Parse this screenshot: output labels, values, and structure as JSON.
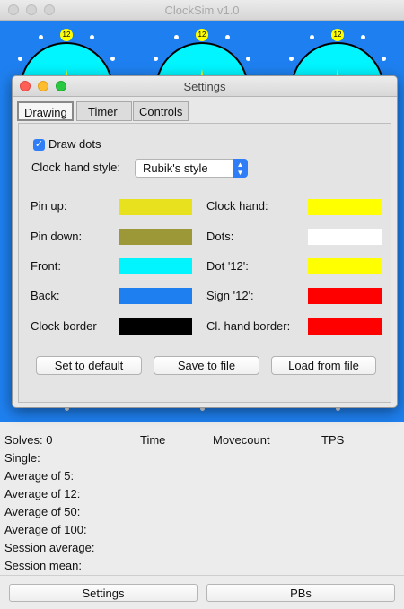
{
  "window": {
    "title": "ClockSim v1.0"
  },
  "clock": {
    "twelve": "12"
  },
  "stats": {
    "solves_label": "Solves: 0",
    "headers": {
      "time": "Time",
      "movecount": "Movecount",
      "tps": "TPS"
    },
    "rows": [
      "Single:",
      "Average of 5:",
      "Average of 12:",
      "Average of 50:",
      "Average of 100:",
      "Session average:",
      "Session mean:"
    ]
  },
  "buttons": {
    "settings": "Settings",
    "pbs": "PBs"
  },
  "settings": {
    "title": "Settings",
    "tabs": [
      "Drawing",
      "Timer",
      "Controls"
    ],
    "draw_dots_label": "Draw dots",
    "draw_dots_checked": true,
    "hand_style_label": "Clock hand style:",
    "hand_style_value": "Rubik's style",
    "colors_left": [
      {
        "label": "Pin up:",
        "color": "#e8e21e"
      },
      {
        "label": "Pin down:",
        "color": "#9c9838"
      },
      {
        "label": "Front:",
        "color": "#00f5ff"
      },
      {
        "label": "Back:",
        "color": "#1e80f0"
      },
      {
        "label": "Clock border",
        "color": "#000000"
      }
    ],
    "colors_right": [
      {
        "label": "Clock hand:",
        "color": "#ffff00"
      },
      {
        "label": "Dots:",
        "color": "#ffffff"
      },
      {
        "label": "Dot '12':",
        "color": "#ffff00"
      },
      {
        "label": "Sign '12':",
        "color": "#ff0000"
      },
      {
        "label": "Cl. hand border:",
        "color": "#ff0000"
      }
    ],
    "buttons": {
      "default": "Set to default",
      "save": "Save to file",
      "load": "Load from file"
    }
  }
}
